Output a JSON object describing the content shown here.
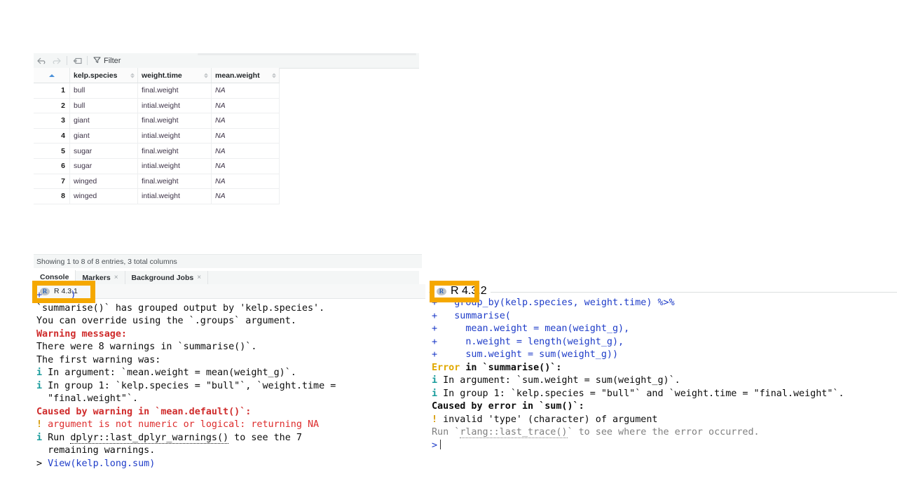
{
  "data_viewer": {
    "toolbar": {
      "back_icon": "arrow-left-icon",
      "forward_icon": "arrow-right-icon",
      "popout_icon": "open-in-new-window-icon",
      "filter_icon": "funnel-icon",
      "filter_label": "Filter"
    },
    "columns": [
      "kelp.species",
      "weight.time",
      "mean.weight"
    ],
    "rows": [
      {
        "n": "1",
        "species": "bull",
        "time": "final.weight",
        "mean": "NA"
      },
      {
        "n": "2",
        "species": "bull",
        "time": "intial.weight",
        "mean": "NA"
      },
      {
        "n": "3",
        "species": "giant",
        "time": "final.weight",
        "mean": "NA"
      },
      {
        "n": "4",
        "species": "giant",
        "time": "intial.weight",
        "mean": "NA"
      },
      {
        "n": "5",
        "species": "sugar",
        "time": "final.weight",
        "mean": "NA"
      },
      {
        "n": "6",
        "species": "sugar",
        "time": "intial.weight",
        "mean": "NA"
      },
      {
        "n": "7",
        "species": "winged",
        "time": "final.weight",
        "mean": "NA"
      },
      {
        "n": "8",
        "species": "winged",
        "time": "intial.weight",
        "mean": "NA"
      }
    ],
    "status": "Showing 1 to 8 of 8 entries, 3 total columns"
  },
  "left_panel": {
    "tabs": [
      {
        "label": "Console",
        "closable": false
      },
      {
        "label": "Markers",
        "closable": true
      },
      {
        "label": "Background Jobs",
        "closable": true
      }
    ],
    "close_glyph": "×",
    "r_logo": "R",
    "r_version": "R 4.3.1",
    "console_lines": [
      [
        {
          "t": "+     )",
          "c": "c-blue"
        }
      ],
      [
        {
          "t": "`summarise()` has grouped output by 'kelp.species'.",
          "c": "c-black"
        }
      ],
      [
        {
          "t": "You can override using the `.groups` argument.",
          "c": "c-black"
        }
      ],
      [
        {
          "t": "Warning message:",
          "c": "c-redb"
        }
      ],
      [
        {
          "t": "There were 8 warnings in `summarise()`.",
          "c": "c-black"
        }
      ],
      [
        {
          "t": "The first warning was:",
          "c": "c-black"
        }
      ],
      [
        {
          "t": "i",
          "c": "c-teal"
        },
        {
          "t": " In argument: `mean.weight = mean(weight_g)`.",
          "c": "c-black"
        }
      ],
      [
        {
          "t": "i",
          "c": "c-teal"
        },
        {
          "t": " In group 1: `kelp.species = \"bull\"`, `weight.time =",
          "c": "c-black"
        }
      ],
      [
        {
          "t": "  \"final.weight\"`.",
          "c": "c-black"
        }
      ],
      [
        {
          "t": "Caused by warning in `mean.default()`:",
          "c": "c-redb"
        }
      ],
      [
        {
          "t": "!",
          "c": "c-orange"
        },
        {
          "t": " argument is not numeric or logical: returning NA",
          "c": "c-red"
        }
      ],
      [
        {
          "t": "i",
          "c": "c-teal"
        },
        {
          "t": " Run ",
          "c": "c-black"
        },
        {
          "t": "dplyr::last_dplyr_warnings()",
          "c": "c-black underdot"
        },
        {
          "t": " to see the 7",
          "c": "c-black"
        }
      ],
      [
        {
          "t": "  remaining warnings.",
          "c": "c-black"
        }
      ],
      [
        {
          "t": "> ",
          "c": "c-black"
        },
        {
          "t": "View(kelp.long.sum)",
          "c": "c-blue"
        }
      ]
    ]
  },
  "right_panel": {
    "r_logo": "R",
    "r_version": "R 4.3.2",
    "console_lines": [
      [
        {
          "t": "+   group_by(kelp.species, weight.time) %>%",
          "c": "c-blue"
        }
      ],
      [
        {
          "t": "+   summarise(",
          "c": "c-blue"
        }
      ],
      [
        {
          "t": "+     mean.weight = mean(weight_g),",
          "c": "c-blue"
        }
      ],
      [
        {
          "t": "+     n.weight = length(weight_g),",
          "c": "c-blue"
        }
      ],
      [
        {
          "t": "+     sum.weight = sum(weight_g))",
          "c": "c-blue"
        }
      ],
      [
        {
          "t": "Error",
          "c": "c-gold"
        },
        {
          "t": " in `summarise()`:",
          "c": "c-blackb"
        }
      ],
      [
        {
          "t": "i",
          "c": "c-teal"
        },
        {
          "t": " In argument: `sum.weight = sum(weight_g)`.",
          "c": "c-black"
        }
      ],
      [
        {
          "t": "i",
          "c": "c-teal"
        },
        {
          "t": " In group 1: `kelp.species = \"bull\"` and `weight.time = \"final.weight\"`.",
          "c": "c-black"
        }
      ],
      [
        {
          "t": "Caused by error in `sum()`:",
          "c": "c-blackb"
        }
      ],
      [
        {
          "t": "!",
          "c": "c-orange"
        },
        {
          "t": " invalid 'type' (character) of argument",
          "c": "c-black"
        }
      ],
      [
        {
          "t": "Run `",
          "c": "c-gray"
        },
        {
          "t": "rlang::last_trace()",
          "c": "c-graylink"
        },
        {
          "t": "` to see where the error occurred.",
          "c": "c-gray"
        }
      ],
      [
        {
          "t": ">",
          "c": "c-blue"
        },
        {
          "t": "CARET",
          "c": "caret-marker"
        }
      ]
    ]
  },
  "annotations": {
    "highlight_color": "#f5a800",
    "boxes": [
      {
        "name": "highlight-r-version-left",
        "target": "R 4.3.1"
      },
      {
        "name": "highlight-r-version-right",
        "target": "R 4.3.2"
      }
    ]
  }
}
